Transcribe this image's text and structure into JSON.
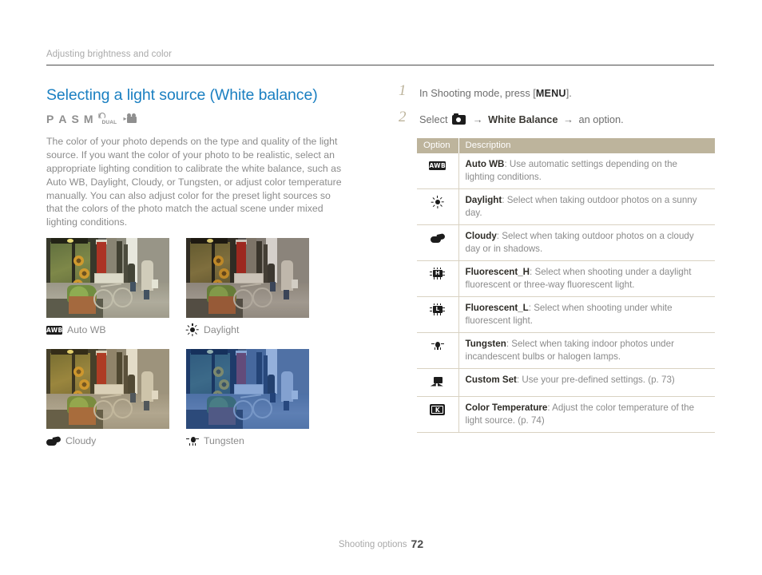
{
  "running_head": "Adjusting brightness and color",
  "section": {
    "title": "Selecting a light source (White balance)",
    "modes": [
      "P",
      "A",
      "S",
      "M"
    ],
    "mode_icons": [
      "dual-is-icon",
      "movie-icon"
    ],
    "body": "The color of your photo depends on the type and quality of the light source. If you want the color of your photo to be realistic, select an appropriate lighting condition to calibrate the white balance, such as Auto WB, Daylight, Cloudy, or Tungsten, or adjust color temperature manually. You can also adjust color for the preset light sources so that the colors of the photo match the actual scene under mixed lighting conditions."
  },
  "samples": [
    {
      "caption": "Auto WB",
      "icon": "auto-wb-icon",
      "tone": "tone-auto"
    },
    {
      "caption": "Daylight",
      "icon": "daylight-icon",
      "tone": "tone-daylight"
    },
    {
      "caption": "Cloudy",
      "icon": "cloudy-icon",
      "tone": "tone-cloudy"
    },
    {
      "caption": "Tungsten",
      "icon": "tungsten-icon",
      "tone": "tone-tungsten"
    }
  ],
  "steps": [
    {
      "num": "1",
      "pre": "In Shooting mode, press [",
      "keyword": "MENU",
      "post": "]."
    },
    {
      "num": "2",
      "pre": "Select",
      "arrow1": "→",
      "bold": "White Balance",
      "arrow2": "→",
      "post": "an option."
    }
  ],
  "table": {
    "headers": [
      "Option",
      "Description"
    ],
    "rows": [
      {
        "icon": "auto-wb-icon",
        "icon_text": "AWB",
        "name": "Auto WB",
        "desc": ": Use automatic settings depending on the lighting conditions."
      },
      {
        "icon": "daylight-icon",
        "icon_text": "",
        "name": "Daylight",
        "desc": ": Select when taking outdoor photos on a sunny day."
      },
      {
        "icon": "cloudy-icon",
        "icon_text": "",
        "name": "Cloudy",
        "desc": ": Select when taking outdoor photos on a cloudy day or in shadows."
      },
      {
        "icon": "fluorescent-h-icon",
        "icon_text": "H",
        "name": "Fluorescent_H",
        "desc": ": Select when shooting under a daylight fluorescent or three-way fluorescent light."
      },
      {
        "icon": "fluorescent-l-icon",
        "icon_text": "L",
        "name": "Fluorescent_L",
        "desc": ": Select when shooting under white fluorescent light."
      },
      {
        "icon": "tungsten-icon",
        "icon_text": "",
        "name": "Tungsten",
        "desc": ": Select when taking indoor photos under incandescent bulbs or halogen lamps."
      },
      {
        "icon": "custom-set-icon",
        "icon_text": "",
        "name": "Custom Set",
        "desc": ": Use your pre-defined settings. (p. 73)"
      },
      {
        "icon": "color-temperature-icon",
        "icon_text": "K",
        "name": "Color Temperature",
        "desc": ": Adjust the color temperature of the light source. (p. 74)"
      }
    ]
  },
  "footer": {
    "label": "Shooting options",
    "page": "72"
  },
  "colors": {
    "title_blue": "#1a7fc1",
    "table_header": "#bdb49c",
    "table_border": "#d9d2c2",
    "body_text": "#8b8b8b",
    "rule": "#4d4d4d"
  }
}
